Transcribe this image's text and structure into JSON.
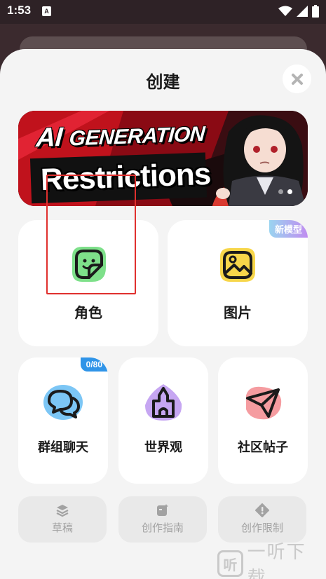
{
  "status_bar": {
    "time": "1:53",
    "notification_glyph": "A"
  },
  "sheet": {
    "title": "创建",
    "close_icon": "close-icon"
  },
  "banner": {
    "line1_prefix": "AI ",
    "line1_suffix": "GENERATION",
    "line2": "Restrictions",
    "page_count": 2,
    "active_page": 2
  },
  "cards": {
    "character": {
      "label": "角色",
      "icon": "sticker-smile-icon",
      "accent": "#7ee08a"
    },
    "image": {
      "label": "图片",
      "icon": "image-icon",
      "accent": "#f7d64a",
      "badge": "新模型"
    },
    "group_chat": {
      "label": "群组聊天",
      "icon": "chat-bubbles-icon",
      "accent": "#7cc6f5",
      "badge": "0/80"
    },
    "worldview": {
      "label": "世界观",
      "icon": "castle-icon",
      "accent": "#c6a6f2"
    },
    "community_post": {
      "label": "社区帖子",
      "icon": "paper-plane-icon",
      "accent": "#f59ca0"
    }
  },
  "bottom_buttons": [
    {
      "label": "草稿",
      "icon": "layers-icon"
    },
    {
      "label": "创作指南",
      "icon": "guide-icon"
    },
    {
      "label": "创作限制",
      "icon": "warning-icon"
    }
  ],
  "watermark": {
    "box_char": "听",
    "text": "一听下载"
  }
}
